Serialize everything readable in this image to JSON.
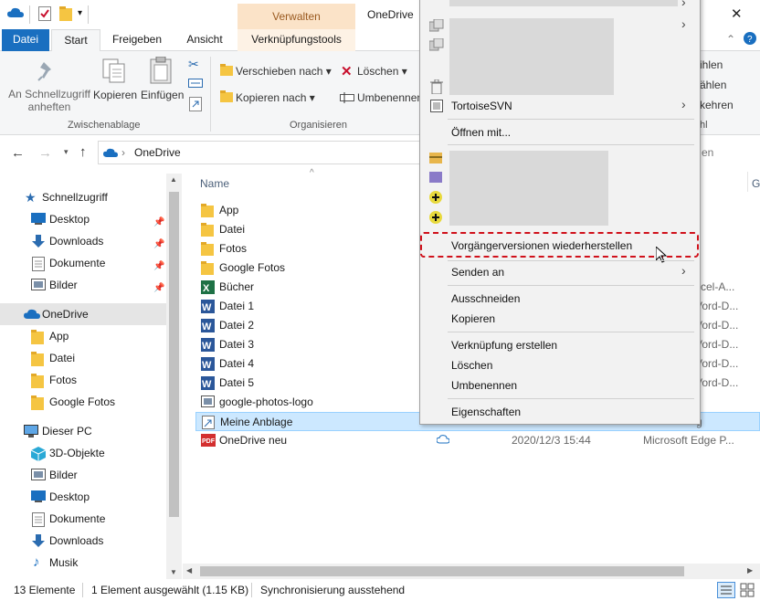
{
  "titlebar": {
    "verwalten": "Verwalten",
    "window_title": "OneDrive",
    "close_glyph": "✕"
  },
  "tabs": {
    "file": "Datei",
    "start": "Start",
    "share": "Freigeben",
    "view": "Ansicht",
    "tools": "Verknüpfungstools"
  },
  "ribbon": {
    "pin_quick": "An Schnellzugriff\nanheften",
    "copy": "Kopieren",
    "paste": "Einfügen",
    "clipboard_group": "Zwischenablage",
    "move_to": "Verschieben nach",
    "copy_to": "Kopieren nach",
    "delete": "Löschen",
    "rename": "Umbenennen",
    "organize_group": "Organisieren",
    "right_partial_1": "ihlen",
    "right_partial_2": "ählen",
    "right_partial_3": "kehren",
    "right_partial_4": "hl"
  },
  "address": {
    "path": "OneDrive",
    "search_partial": "en"
  },
  "nav": {
    "quick_access": "Schnellzugriff",
    "quick_items": [
      "Desktop",
      "Downloads",
      "Dokumente",
      "Bilder"
    ],
    "onedrive": "OneDrive",
    "onedrive_items": [
      "App",
      "Datei",
      "Fotos",
      "Google Fotos"
    ],
    "this_pc": "Dieser PC",
    "pc_items": [
      "3D-Objekte",
      "Bilder",
      "Desktop",
      "Dokumente",
      "Downloads",
      "Musik"
    ]
  },
  "list": {
    "col_name": "Name",
    "col_g_partial": "G",
    "files": [
      {
        "name": "App",
        "type": "folder",
        "kind": ""
      },
      {
        "name": "Datei",
        "type": "folder",
        "kind": ""
      },
      {
        "name": "Fotos",
        "type": "folder",
        "kind": ""
      },
      {
        "name": "Google Fotos",
        "type": "folder",
        "kind": ""
      },
      {
        "name": "Bücher",
        "type": "excel",
        "kind": "xcel-A..."
      },
      {
        "name": "Datei 1",
        "type": "word",
        "kind": "Vord-D..."
      },
      {
        "name": "Datei 2",
        "type": "word",
        "kind": "Vord-D..."
      },
      {
        "name": "Datei 3",
        "type": "word",
        "kind": "Vord-D..."
      },
      {
        "name": "Datei 4",
        "type": "word",
        "kind": "Vord-D..."
      },
      {
        "name": "Datei 5",
        "type": "word",
        "kind": "Vord-D..."
      },
      {
        "name": "google-photos-logo",
        "type": "image",
        "kind": ""
      },
      {
        "name": "Meine Anblage",
        "type": "shortcut",
        "kind": "g"
      },
      {
        "name": "OneDrive neu",
        "type": "pdf",
        "kind": "Microsoft Edge P...",
        "date": "2020/12/3 15:44"
      }
    ]
  },
  "context_menu": {
    "tortoise": "TortoiseSVN",
    "open_with": "Öffnen mit...",
    "restore": "Vorgängerversionen wiederherstellen",
    "send_to": "Senden an",
    "cut": "Ausschneiden",
    "copy": "Kopieren",
    "create_shortcut": "Verknüpfung erstellen",
    "delete": "Löschen",
    "rename": "Umbenennen",
    "properties": "Eigenschaften"
  },
  "status": {
    "count": "13 Elemente",
    "selected": "1 Element ausgewählt (1.15 KB)",
    "sync": "Synchronisierung ausstehend"
  },
  "colors": {
    "accent": "#1a6fc0",
    "selection": "#cce8ff",
    "highlight_dashed": "#d0111b",
    "tools_tab": "#fbe3c8"
  }
}
